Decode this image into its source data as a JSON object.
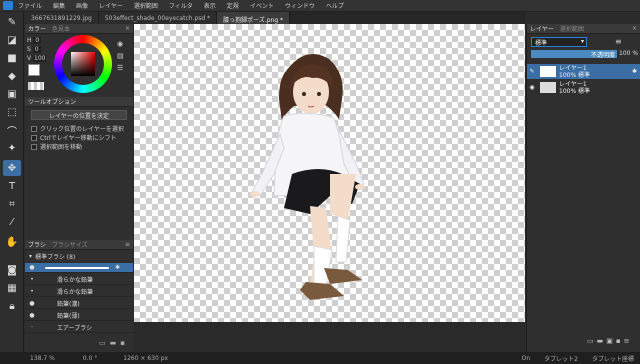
{
  "menu": [
    "ファイル",
    "編集",
    "画像",
    "レイヤー",
    "選択範囲",
    "フィルタ",
    "表示",
    "定規",
    "イベント",
    "ウィンドウ",
    "ヘルプ"
  ],
  "tabs": [
    "3667631891229.jpg",
    "503effect_shade_00eyecatch.psd *",
    "膝っ抱脚ポーズ.png *"
  ],
  "color_panel": {
    "tab1": "カラー",
    "tab2": "色見本",
    "h": "0",
    "s": "0",
    "v": "100"
  },
  "tool_options": {
    "title": "ツールオプション",
    "button": "レイヤーの位置を決定",
    "opt1": "クリック位置のレイヤーを選択",
    "opt2": "Ctrlでレイヤー移動にシフト",
    "opt3": "選択範囲を移動"
  },
  "brush": {
    "tab1": "ブラシ",
    "tab2": "ブラシサイズ",
    "group": "標準ブラシ (8)",
    "items": [
      "",
      "滑らかな鉛筆",
      "滑らかな鉛筆",
      "鉛筆(濃)",
      "鉛筆(薄)",
      "エアーブラシ"
    ]
  },
  "layers": {
    "tab1": "レイヤー",
    "tab2": "選択範囲",
    "blend": "標準",
    "opacity_label": "不透明度",
    "opacity": "100 %",
    "items": [
      {
        "name": "レイヤー1",
        "info": "100% 標準"
      },
      {
        "name": "レイヤー1",
        "info": "100% 標準"
      }
    ]
  },
  "status": {
    "zoom": "138.7 %",
    "angle": "0.0 °",
    "size": "1260 × 630 px",
    "on": "On",
    "tablet": "タブレット2",
    "tablet_mode": "タブレット座標"
  },
  "colors": {
    "accent": "#3a6ea5",
    "bg": "#2b2b2b"
  }
}
